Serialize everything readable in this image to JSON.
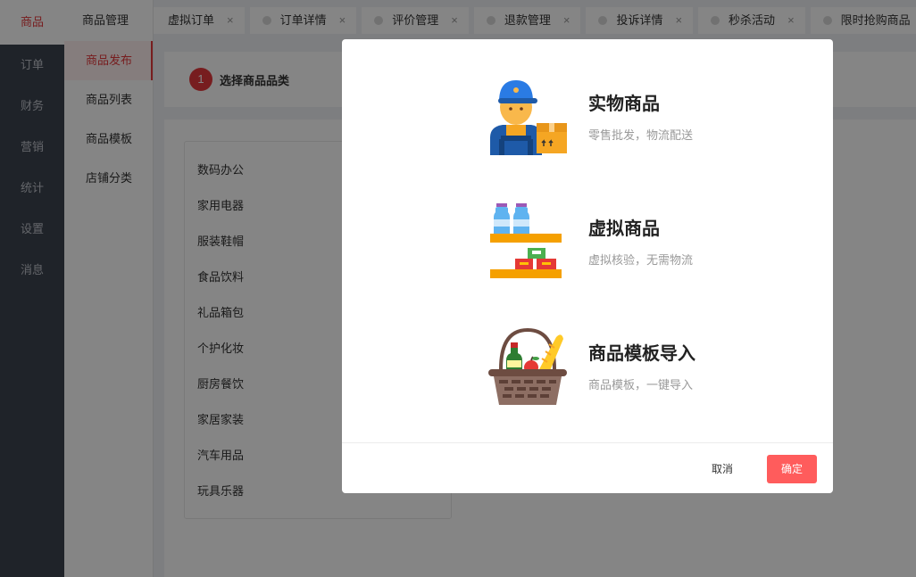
{
  "nav_primary": {
    "items": [
      {
        "label": "商品"
      },
      {
        "label": "订单"
      },
      {
        "label": "财务"
      },
      {
        "label": "营销"
      },
      {
        "label": "统计"
      },
      {
        "label": "设置"
      },
      {
        "label": "消息"
      }
    ],
    "active_index": 0
  },
  "nav_secondary": {
    "title": "商品管理",
    "items": [
      {
        "label": "商品发布"
      },
      {
        "label": "商品列表"
      },
      {
        "label": "商品模板"
      },
      {
        "label": "店铺分类"
      }
    ],
    "active_index": 0
  },
  "tabs": [
    {
      "label": "虚拟订单"
    },
    {
      "label": "订单详情"
    },
    {
      "label": "评价管理"
    },
    {
      "label": "退款管理"
    },
    {
      "label": "投诉详情"
    },
    {
      "label": "秒杀活动"
    },
    {
      "label": "限时抢购商品"
    }
  ],
  "tab_close_glyph": "×",
  "step": {
    "number": "1",
    "label": "选择商品品类"
  },
  "categories": [
    "数码办公",
    "家用电器",
    "服装鞋帽",
    "食品饮料",
    "礼品箱包",
    "个护化妆",
    "厨房餐饮",
    "家居家装",
    "汽车用品",
    "玩具乐器"
  ],
  "modal": {
    "options": [
      {
        "name": "实物商品",
        "desc": "零售批发，物流配送",
        "icon": "delivery-worker-icon"
      },
      {
        "name": "虚拟商品",
        "desc": "虚拟核验，无需物流",
        "icon": "shelf-goods-icon"
      },
      {
        "name": "商品模板导入",
        "desc": "商品模板，一键导入",
        "icon": "grocery-basket-icon"
      }
    ],
    "cancel_label": "取消",
    "ok_label": "确定"
  },
  "colors": {
    "accent": "#e4393c",
    "ok_button": "#ff5c5c",
    "nav_bg": "#3d4450"
  }
}
